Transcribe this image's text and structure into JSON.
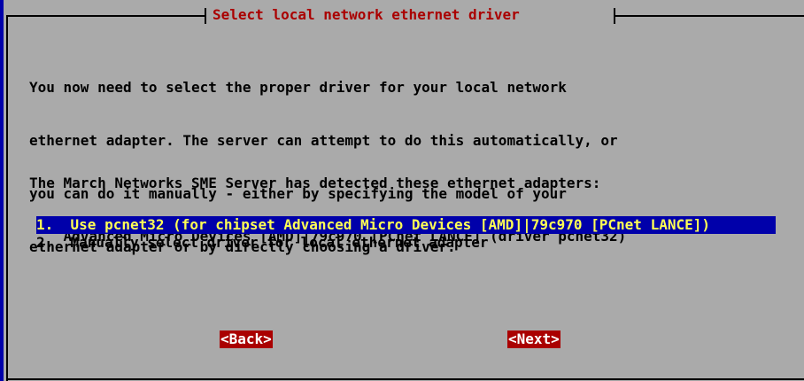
{
  "dialog": {
    "title": "Select local network ethernet driver",
    "description_lines": [
      "You now need to select the proper driver for your local network",
      "ethernet adapter. The server can attempt to do this automatically, or",
      "you can do it manually - either by specifying the model of your",
      "ethernet adapter or by directly choosing a driver."
    ],
    "detected_heading": "The March Networks SME Server has detected these ethernet adapters:",
    "detected_adapter": "    Advanced Micro Devices [AMD]|79c970 [PCnet LANCE] (driver pcnet32)",
    "menu_items": [
      {
        "label": "1.  Use pcnet32 (for chipset Advanced Micro Devices [AMD]|79c970 [PCnet LANCE])",
        "selected": true
      },
      {
        "label": "2.  Manually select driver for local ethernet adapter",
        "selected": false
      }
    ],
    "buttons": {
      "back": "<Back>",
      "next": "<Next>"
    }
  },
  "colors": {
    "background": "#aaaaaa",
    "title_text": "#aa0000",
    "selection_bg": "#0000aa",
    "selection_text": "#ffff55",
    "button_bg": "#aa0000",
    "button_text": "#ffffff"
  }
}
